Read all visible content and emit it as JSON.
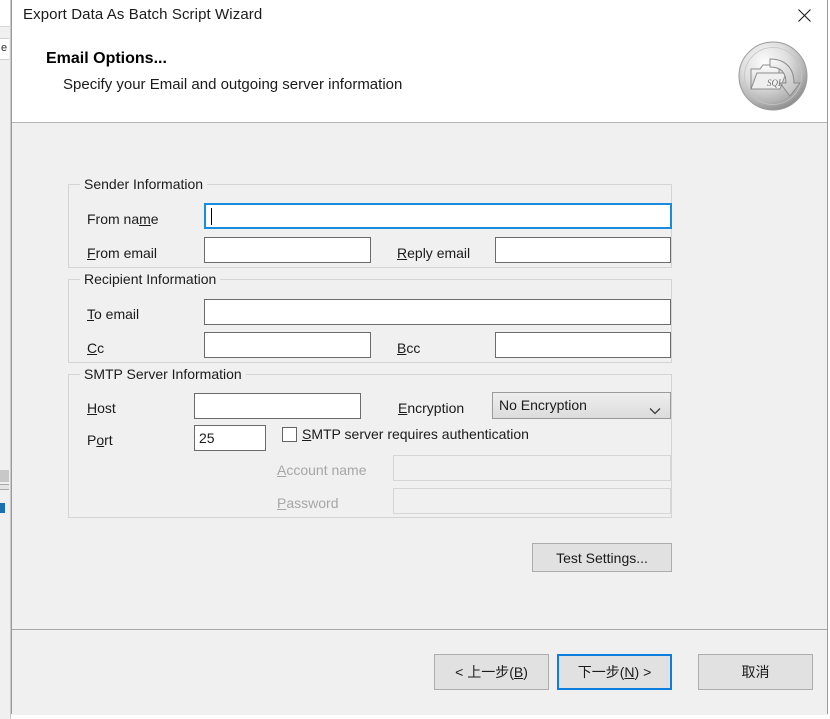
{
  "window": {
    "title": "Export Data As Batch Script Wizard",
    "close_icon": "close-icon"
  },
  "banner": {
    "heading": "Email Options...",
    "subheading": "Specify your Email and outgoing server information",
    "icon_name": "sql-export-folder-icon",
    "icon_badge_text": "SQL"
  },
  "groups": {
    "sender": {
      "title": "Sender Information",
      "fields": {
        "from_name": {
          "label_pre": "From na",
          "label_accel": "m",
          "label_post": "e",
          "value": "",
          "placeholder": "",
          "focused": true
        },
        "from_email": {
          "label_pre": "",
          "label_accel": "F",
          "label_post": "rom email",
          "value": "",
          "placeholder": ""
        },
        "reply_email": {
          "label_pre": "",
          "label_accel": "R",
          "label_post": "eply email",
          "value": "",
          "placeholder": ""
        }
      }
    },
    "recipient": {
      "title": "Recipient Information",
      "fields": {
        "to_email": {
          "label_pre": "",
          "label_accel": "T",
          "label_post": "o email",
          "value": "",
          "placeholder": ""
        },
        "cc": {
          "label_pre": "",
          "label_accel": "C",
          "label_post": "c",
          "value": "",
          "placeholder": ""
        },
        "bcc": {
          "label_pre": "",
          "label_accel": "B",
          "label_post": "cc",
          "value": "",
          "placeholder": ""
        }
      }
    },
    "smtp": {
      "title": "SMTP Server Information",
      "fields": {
        "host": {
          "label_pre": "",
          "label_accel": "H",
          "label_post": "ost",
          "value": "",
          "placeholder": ""
        },
        "port": {
          "label_pre": "P",
          "label_accel": "o",
          "label_post": "rt",
          "value": "25",
          "placeholder": ""
        },
        "encryption": {
          "label_pre": "",
          "label_accel": "E",
          "label_post": "ncryption",
          "selected": "No Encryption",
          "options": [
            "No Encryption"
          ],
          "arrow_icon": "chevron-down-icon"
        },
        "requires_auth": {
          "label_pre": "",
          "label_accel": "S",
          "label_post": "MTP server requires authentication",
          "checked": false
        },
        "account_name": {
          "label_pre": "",
          "label_accel": "A",
          "label_post": "ccount name",
          "value": "",
          "placeholder": "",
          "disabled": true
        },
        "password": {
          "label_pre": "",
          "label_accel": "P",
          "label_post": "assword",
          "value": "",
          "placeholder": "",
          "disabled": true
        }
      }
    }
  },
  "buttons": {
    "test_settings": "Test Settings...",
    "back_pre": "< 上一步(",
    "back_accel": "B",
    "back_post": ")",
    "next_pre": "下一步(",
    "next_accel": "N",
    "next_post": ") >",
    "cancel": "取消"
  },
  "colors": {
    "accent": "#0a7fe0",
    "focus_border": "#1a8ce0",
    "dialog_bg": "#f0f0f0",
    "banner_bg": "#ffffff",
    "button_bg": "#e1e1e1",
    "disabled_text": "#a6a6a6"
  }
}
